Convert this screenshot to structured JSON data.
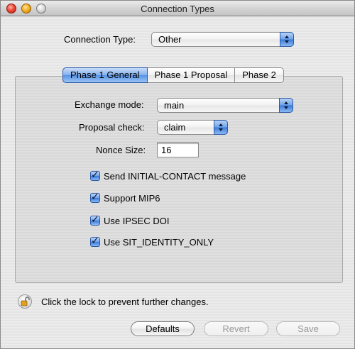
{
  "window": {
    "title": "Connection Types"
  },
  "connection_type": {
    "label": "Connection Type:",
    "value": "Other"
  },
  "tabs": [
    {
      "label": "Phase 1 General",
      "active": true
    },
    {
      "label": "Phase 1 Proposal",
      "active": false
    },
    {
      "label": "Phase 2",
      "active": false
    }
  ],
  "exchange_mode": {
    "label": "Exchange mode:",
    "value": "main"
  },
  "proposal_check": {
    "label": "Proposal check:",
    "value": "claim"
  },
  "nonce_size": {
    "label": "Nonce Size:",
    "value": "16"
  },
  "checkboxes": [
    {
      "label": "Send INITIAL-CONTACT message",
      "checked": true
    },
    {
      "label": "Support MIP6",
      "checked": true
    },
    {
      "label": "Use IPSEC DOI",
      "checked": true
    },
    {
      "label": "Use SIT_IDENTITY_ONLY",
      "checked": true
    }
  ],
  "lock": {
    "text": "Click the lock to prevent further changes.",
    "icon": "lock-open-icon"
  },
  "buttons": {
    "defaults": "Defaults",
    "revert": "Revert",
    "save": "Save"
  },
  "colors": {
    "accent": "#3b7ad8",
    "window_bg": "#ececec"
  }
}
